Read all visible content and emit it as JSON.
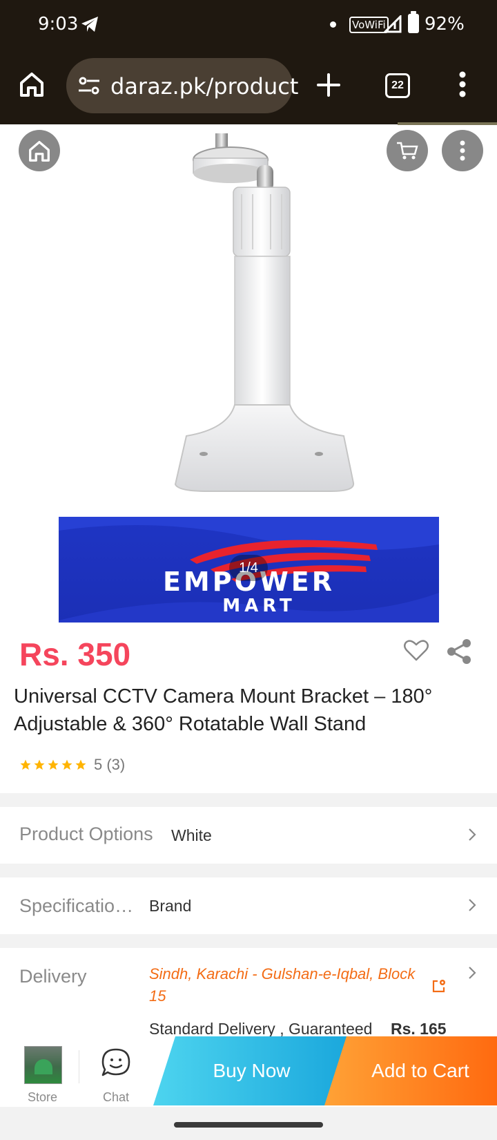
{
  "status_bar": {
    "time": "9:03",
    "wifi_label": "VoWiFi",
    "battery": "92%"
  },
  "browser": {
    "url": "daraz.pk/product",
    "tab_count": "22"
  },
  "gallery": {
    "counter": "1/4",
    "banner_line1": "EMPOWER",
    "banner_line2": "MART"
  },
  "product": {
    "price": "Rs. 350",
    "title": "Universal CCTV Camera Mount Bracket – 180° Adjustable & 360° Rotatable Wall Stand",
    "rating_value": 5,
    "rating_text": "5 (3)"
  },
  "options": {
    "label": "Product Options",
    "value": "White"
  },
  "specifications": {
    "label": "Specificatio…",
    "value": "Brand"
  },
  "delivery": {
    "label": "Delivery",
    "address": "Sindh, Karachi - Gulshan-e-Iqbal, Block 15",
    "method": "Standard Delivery , Guaranteed",
    "fee": "Rs. 165"
  },
  "bottom_bar": {
    "store_label": "Store",
    "chat_label": "Chat",
    "buy_now": "Buy Now",
    "add_to_cart": "Add to Cart"
  },
  "colors": {
    "price": "#f5455c",
    "address": "#f36c15",
    "buy_now": "#1aa7dc",
    "add_to_cart": "#ff6a10",
    "star": "#ffb400"
  }
}
